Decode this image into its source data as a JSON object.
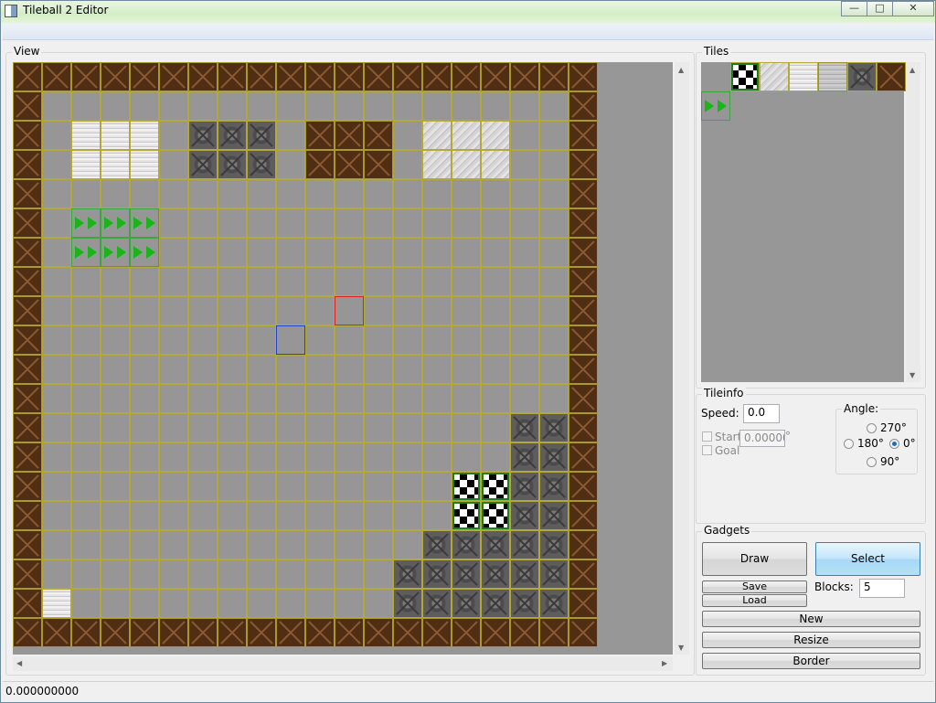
{
  "window": {
    "title": "Tileball 2 Editor"
  },
  "colors": {
    "title_bar": "#d3edc6",
    "view_bg": "#979797",
    "grid_line": "#b3a93a",
    "select_button": "#a7d9f5"
  },
  "view": {
    "label": "View",
    "legend": {
      ".": "empty",
      "W": "wooden-crate",
      "M": "metal-block",
      "I": "ice",
      "S": "slide-tile",
      "C": "checkered-goal",
      "A": "speed-arrows"
    },
    "rows": [
      "WWWWWWWWWWWWWWWWWWWW",
      "W..................W",
      "W.III.MMM.WWW.SSS..W",
      "W.III.MMM.WWW.SSS..W",
      "W..................W",
      "W.AAA..............W",
      "W.AAA..............W",
      "W..................W",
      "W..................W",
      "W..................W",
      "W..................W",
      "W..................W",
      "W................MMW",
      "W................MMW",
      "W..............CCMMW",
      "W..............CCMMW",
      "W.............MMMMMW",
      "W............MMMMMMW",
      "WI...........MMMMMMW",
      "WWWWWWWWWWWWWWWWWWWW"
    ],
    "highlight_red": {
      "row": 8,
      "col": 11
    },
    "highlight_blue": {
      "row": 9,
      "col": 9
    }
  },
  "tiles_panel": {
    "label": "Tiles",
    "palette": [
      "empty",
      "checkered-goal",
      "slide-tile",
      "ice",
      "ice-dark",
      "metal-block",
      "wooden-crate",
      "speed-arrows"
    ]
  },
  "tileinfo": {
    "label": "Tileinfo",
    "speed_label": "Speed:",
    "speed_value": "0.0",
    "start_label": "Start",
    "start_value": "0.000000",
    "start_suffix": "°",
    "goal_label": "Goal",
    "angle_label": "Angle:",
    "angle_270": "270°",
    "angle_180": "180°",
    "angle_0": "0°",
    "angle_90": "90°",
    "angle_selected": "0°"
  },
  "gadgets": {
    "label": "Gadgets",
    "draw": "Draw",
    "select": "Select",
    "save": "Save",
    "load": "Load",
    "blocks_label": "Blocks:",
    "blocks_value": "5",
    "new": "New",
    "resize": "Resize",
    "border": "Border"
  },
  "status": {
    "text": "0.000000000"
  }
}
